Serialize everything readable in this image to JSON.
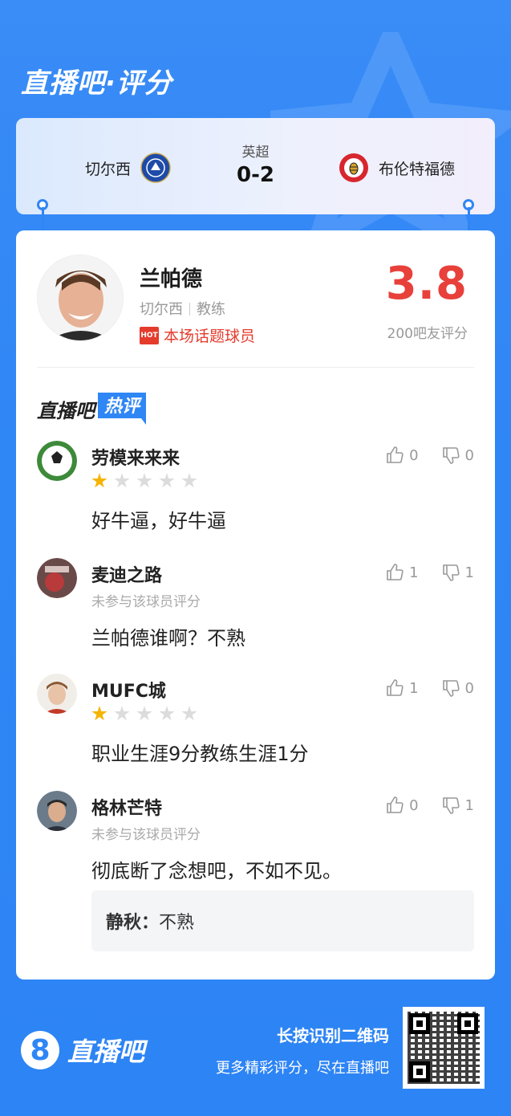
{
  "brand": {
    "title": "直播吧·评分"
  },
  "match": {
    "league": "英超",
    "score": "0-2",
    "home_team": "切尔西",
    "away_team": "布伦特福德",
    "home_crest_color": "#1e4aa8",
    "away_crest_color": "#d7262e"
  },
  "player": {
    "name": "兰帕德",
    "team": "切尔西",
    "role": "教练",
    "hot_badge": "HOT",
    "hot_label": "本场话题球员",
    "rating": "3.8",
    "rating_label": "200吧友评分"
  },
  "hot_section": {
    "title_a": "直播吧",
    "title_b": "热评"
  },
  "comments": [
    {
      "name": "劳模来来来",
      "stars": 1,
      "sub": "",
      "text": "好牛逼，好牛逼",
      "likes": "0",
      "dislikes": "0"
    },
    {
      "name": "麦迪之路",
      "stars": 0,
      "sub": "未参与该球员评分",
      "text": "兰帕德谁啊？不熟",
      "likes": "1",
      "dislikes": "1"
    },
    {
      "name": "MUFC城",
      "stars": 1,
      "sub": "",
      "text": "职业生涯9分教练生涯1分",
      "likes": "1",
      "dislikes": "0"
    },
    {
      "name": "格林芒特",
      "stars": 0,
      "sub": "未参与该球员评分",
      "text": "彻底断了念想吧，不如不见。",
      "likes": "0",
      "dislikes": "1"
    }
  ],
  "reply": {
    "author": "静秋：",
    "text": "不熟"
  },
  "footer": {
    "logo_mark": "8",
    "logo_text": "直播吧",
    "qr_title": "长按识别二维码",
    "qr_sub": "更多精彩评分，尽在直播吧"
  },
  "colors": {
    "accent": "#2f86f5",
    "rating": "#e8403a",
    "star": "#f5b400"
  }
}
